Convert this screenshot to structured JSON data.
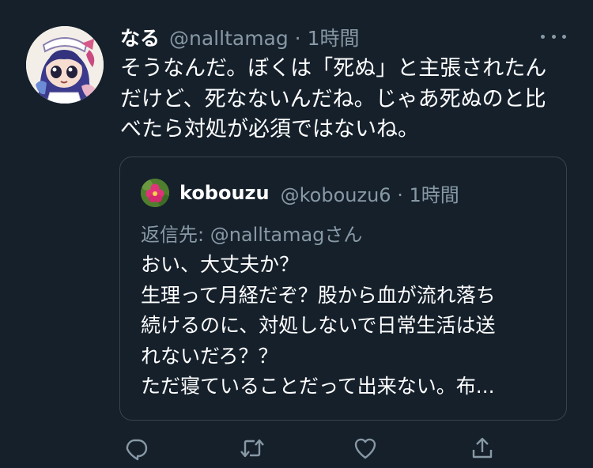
{
  "tweet": {
    "name": "なる",
    "handle": "@nalltamag · 1時間",
    "body_lines": [
      "そうなんだ。ぼくは「死ぬ」と主張されたん",
      "だけど、死なないんだね。じゃあ死ぬのと比",
      "べたら対処が必須ではないね。"
    ]
  },
  "quote": {
    "name": "kobouzu",
    "handle": "@kobouzu6 · 1時間",
    "reply_to": "返信先: @nalltamagさん",
    "lines": [
      "おい、大丈夫か？",
      "生理って月経だぞ？股から血が流れ落ち",
      "続けるのに、対処しないで日常生活は送",
      "れないだろ？？",
      "ただ寝ていることだって出来ない。布..."
    ]
  },
  "icons": {
    "more": "more-horizontal-icon",
    "reply": "reply-icon",
    "retweet": "retweet-icon",
    "like": "heart-icon",
    "share": "share-icon"
  },
  "colors": {
    "background": "#15202b",
    "text": "#ffffff",
    "secondary": "#8899a6",
    "border": "#38444d"
  }
}
